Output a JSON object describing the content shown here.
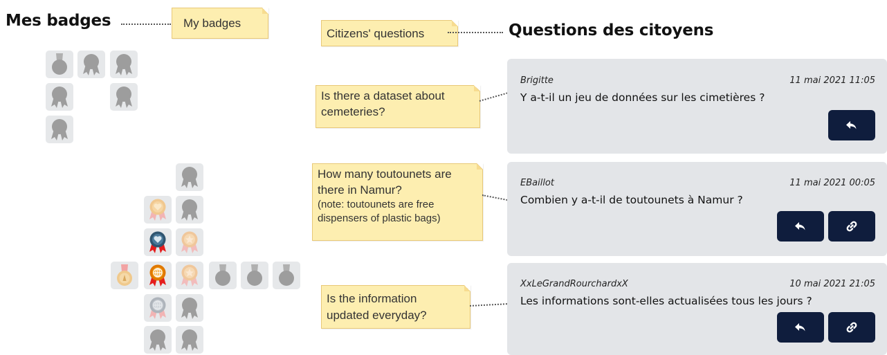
{
  "badges_heading": "Mes badges",
  "questions_heading": "Questions des citoyens",
  "annotations": {
    "my_badges": "My badges",
    "citizens_questions": "Citizens' questions",
    "q1": [
      "Is there a dataset about",
      "cemeteries?"
    ],
    "q2": [
      "How many toutounets are",
      "there in Namur?"
    ],
    "q2_note": [
      "(note: toutounets are free",
      "dispensers of plastic bags)"
    ],
    "q3": [
      "Is the information",
      "updated everyday?"
    ]
  },
  "questions": [
    {
      "author": "Brigitte",
      "date": "11 mai 2021 11:05",
      "text": "Y a-t-il un jeu de données sur les cimetières ?",
      "buttons": [
        "reply-icon"
      ]
    },
    {
      "author": "EBaillot",
      "date": "11 mai 2021 00:05",
      "text": "Combien y a-t-il de toutounets à Namur ?",
      "buttons": [
        "reply-icon",
        "link-icon"
      ]
    },
    {
      "author": "XxLeGrandRourchardxX",
      "date": "10 mai 2021 21:05",
      "text": "Les informations sont-elles actualisées tous les jours ?",
      "buttons": [
        "reply-icon",
        "link-icon"
      ]
    }
  ],
  "badge_icons": {
    "locked_ribbon": "locked-ribbon-badge-icon",
    "locked_medal": "locked-medal-badge-icon",
    "heart_peach": "heart-badge-icon",
    "heart_blue": "heart-badge-icon",
    "star_peach": "star-badge-icon",
    "globe_orange": "globe-badge-icon",
    "globe_grey": "globe-badge-icon",
    "medal_gold": "gold-medal-icon"
  },
  "colors": {
    "button": "#0f1d3d",
    "card": "#e3e5e8",
    "note": "#fdeeb0",
    "locked": "#9d9d9d"
  }
}
